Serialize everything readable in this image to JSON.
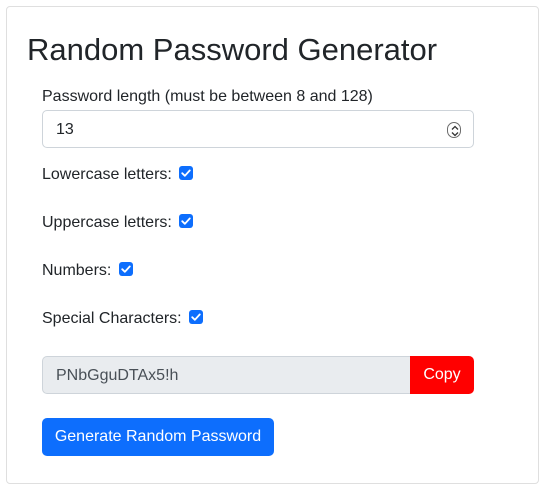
{
  "title": "Random Password Generator",
  "length": {
    "label": "Password length (must be between 8 and 128)",
    "value": "13"
  },
  "options": {
    "lowercase": {
      "label": "Lowercase letters:",
      "checked": true
    },
    "uppercase": {
      "label": "Uppercase letters:",
      "checked": true
    },
    "numbers": {
      "label": "Numbers:",
      "checked": true
    },
    "special": {
      "label": "Special Characters:",
      "checked": true
    }
  },
  "output": {
    "value": "PNbGguDTAx5!h",
    "copy_label": "Copy"
  },
  "generate_label": "Generate Random Password",
  "colors": {
    "primary": "#0d6efd",
    "copy": "#ff0000",
    "readonly_bg": "#e9ecef"
  }
}
